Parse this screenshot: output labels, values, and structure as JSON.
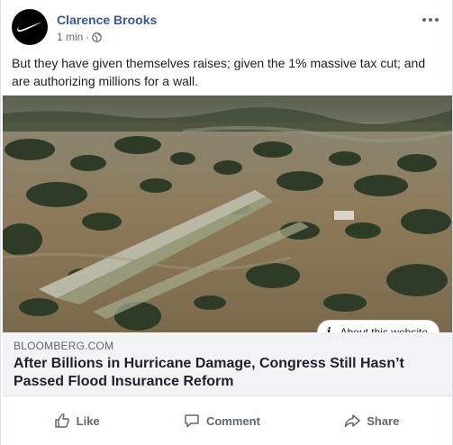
{
  "post": {
    "author": "Clarence Brooks",
    "time": "1 min",
    "separator": "·",
    "body_text": "But they have given themselves raises; given the 1% massive tax cut; and are authorizing millions for a wall.",
    "avatar_icon": "swoosh-logo",
    "privacy_icon": "globe-icon"
  },
  "link": {
    "about_label": "About this website",
    "domain": "BLOOMBERG.COM",
    "headline": "After Billions in Hurricane Damage, Congress Still Hasn’t Passed Flood Insurance Reform"
  },
  "actions": {
    "like": "Like",
    "comment": "Comment",
    "share": "Share"
  },
  "colors": {
    "author_blue": "#385898",
    "meta_gray": "#616770",
    "link_bg": "#f2f3f5"
  }
}
